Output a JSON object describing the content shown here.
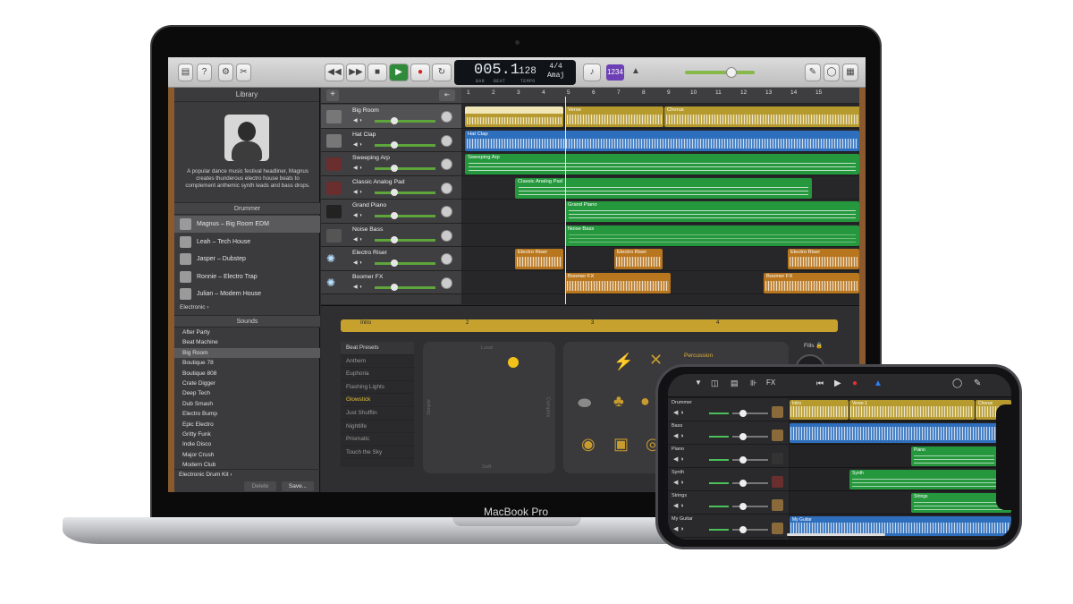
{
  "laptop": {
    "brand_label": "MacBook Pro",
    "lcd": {
      "position": "005.1",
      "tempo": "128",
      "signature": "4/4",
      "key": "Amaj",
      "bar_cap": "BAR",
      "beat_cap": "BEAT",
      "tempo_cap": "TEMPO"
    },
    "count_in": "1234",
    "library": {
      "title": "Library",
      "description": "A popular dance music festival headliner, Magnus creates thunderous electro house beats to complement anthemic synth leads and bass drops.",
      "drummer_header": "Drummer",
      "drummers": [
        "Magnus – Big Room EDM",
        "Leah – Tech House",
        "Jasper – Dubstep",
        "Ronnie – Electro Trap",
        "Julian – Modern House"
      ],
      "genre": "Electronic",
      "sounds_header": "Sounds",
      "sounds": [
        "After Party",
        "Beat Machine",
        "Big Room",
        "Boutique 78",
        "Boutique 808",
        "Crate Digger",
        "Deep Tech",
        "Dub Smash",
        "Electro Bump",
        "Epic Electro",
        "Gritty Funk",
        "Indie Disco",
        "Major Crush",
        "Modern Club"
      ],
      "kit": "Electronic Drum Kit",
      "delete_label": "Delete",
      "save_label": "Save..."
    },
    "tracks": [
      "Big Room",
      "Hat Clap",
      "Sweeping Arp",
      "Classic Analog Pad",
      "Grand Piano",
      "Noise Bass",
      "Electro Riser",
      "Boomer FX"
    ],
    "ruler": [
      "1",
      "2",
      "3",
      "4",
      "5",
      "6",
      "7",
      "8",
      "9",
      "10",
      "11",
      "12",
      "13",
      "14",
      "15"
    ],
    "regions": {
      "intro": "Intro",
      "verse": "Verse",
      "chorus": "Chorus",
      "hat_clap": "Hat Clap",
      "sweeping_arp": "Sweeping Arp",
      "classic_pad": "Classic Analog Pad",
      "grand_piano": "Grand Piano",
      "noise_bass": "Noise Bass",
      "riser": "Electro Riser",
      "boomer": "Boomer FX"
    },
    "editor": {
      "region": "Intro",
      "ruler": [
        "2",
        "3",
        "4"
      ],
      "presets_header": "Beat Presets",
      "presets": [
        "Anthem",
        "Euphoria",
        "Flashing Lights",
        "Glowstick",
        "Just Shufflin",
        "Nightlife",
        "Prismatic",
        "Touch the Sky"
      ],
      "pad_loud": "Loud",
      "pad_soft": "Soft",
      "pad_simple": "Simple",
      "pad_complex": "Complex",
      "percussion": "Percussion",
      "fills": "Fills"
    }
  },
  "phone": {
    "fx_label": "FX",
    "tracks": [
      "Drummer",
      "Bass",
      "Piano",
      "Synth",
      "Strings",
      "My Guitar"
    ],
    "regions": {
      "intro": "Intro",
      "verse": "Verse 1",
      "chorus": "Chorus",
      "piano": "Piano",
      "synth": "Synth",
      "strings": "Strings",
      "guitar": "My Guitar"
    }
  },
  "colors": {
    "drummer": "#b69a2d",
    "audio": "#2e6fbd",
    "midi": "#25983d",
    "fx": "#b8761e",
    "accent": "#f2c21b"
  }
}
